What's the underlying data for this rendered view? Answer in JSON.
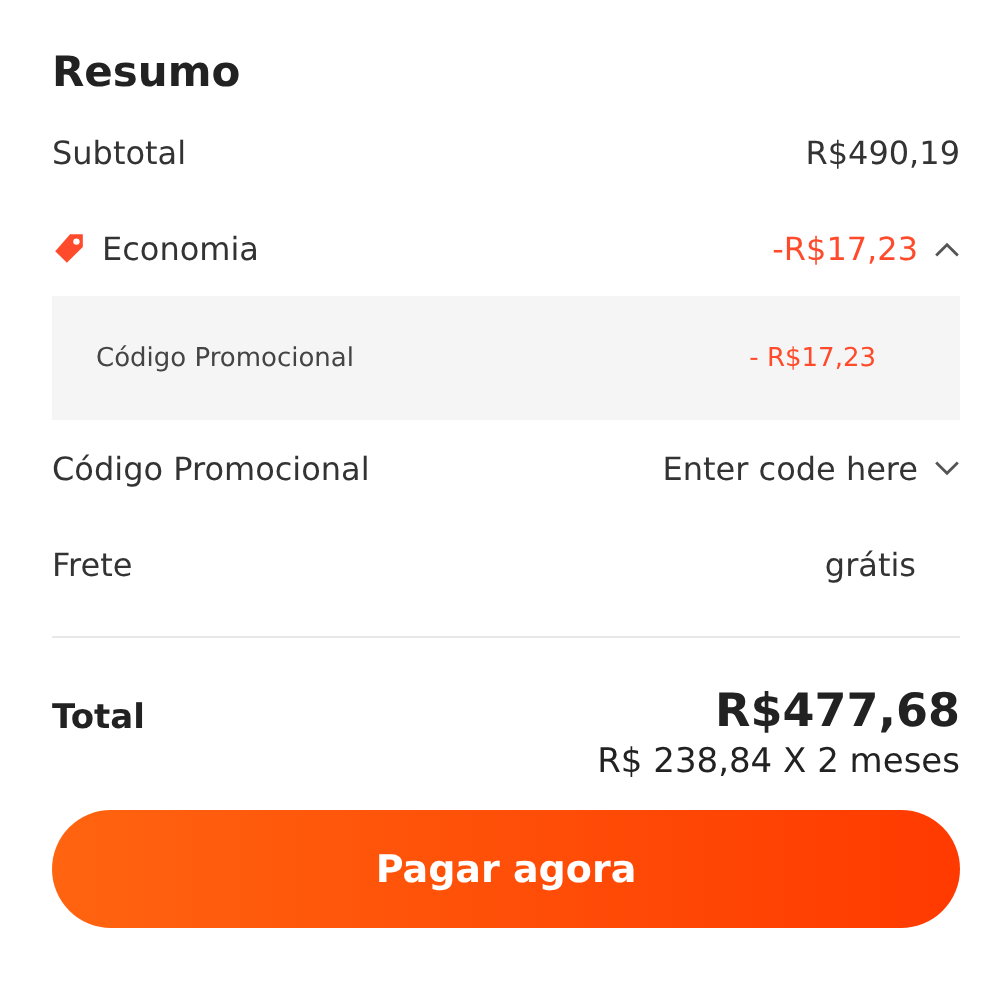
{
  "title": "Resumo",
  "subtotal": {
    "label": "Subtotal",
    "value": "R$490,19"
  },
  "savings": {
    "label": "Economia",
    "value": "-R$17,23",
    "expanded": true,
    "items": [
      {
        "label": "Código Promocional",
        "value": "- R$17,23"
      }
    ]
  },
  "promo": {
    "label": "Código Promocional",
    "value": "Enter code here",
    "expanded": false
  },
  "shipping": {
    "label": "Frete",
    "value": "grátis"
  },
  "total": {
    "label": "Total",
    "value": "R$477,68",
    "installments": "R$ 238,84 X 2 meses"
  },
  "pay_button": "Pagar agora"
}
